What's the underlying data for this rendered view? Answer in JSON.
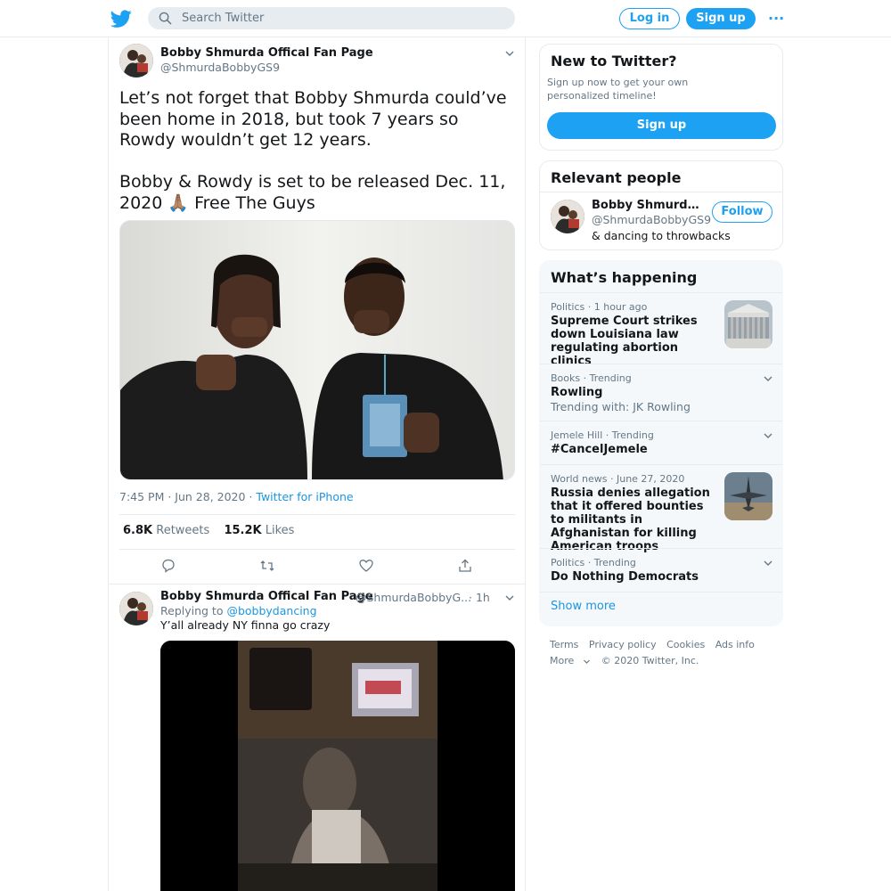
{
  "header": {
    "search_placeholder": "Search Twitter",
    "login_label": "Log in",
    "signup_label": "Sign up",
    "more_icon": "···"
  },
  "tweet": {
    "author_name": "Bobby Shmurda Offical Fan Page",
    "author_handle": "@ShmurdaBobbyGS9",
    "text": "Let’s not forget that Bobby Shmurda could’ve been home in 2018, but took 7 years so Rowdy wouldn’t get 12 years.\n\nBobby & Rowdy is set to be released Dec. 11, 2020 🙏🏽 Free The Guys",
    "time": "7:45 PM · Jun 28, 2020 · ",
    "source": "Twitter for iPhone",
    "retweets_count": "6.8K",
    "retweets_label": "Retweets",
    "likes_count": "15.2K",
    "likes_label": "Likes"
  },
  "reply": {
    "author_name": "Bobby Shmurda Offical Fan Page",
    "author_handle": "@ShmurdaBobbyG...",
    "time": "· 1h",
    "replying_prefix": "Replying to ",
    "replying_to": "@bobbydancing",
    "text": "Y’all already NY finna go crazy"
  },
  "new_to_twitter": {
    "title": "New to Twitter?",
    "description": "Sign up now to get your own personalized timeline!",
    "signup_label": "Sign up"
  },
  "relevant_people": {
    "title": "Relevant people",
    "name": "Bobby Shmurda ...",
    "handle": "@ShmurdaBobbyGS9",
    "bio": "& dancing to throwbacks",
    "follow_label": "Follow"
  },
  "whats_happening": {
    "title": "What’s happening",
    "trends": [
      {
        "meta": "Politics · 1 hour ago",
        "title": "Supreme Court strikes down Louisiana law regulating abortion clinics",
        "sub": ""
      },
      {
        "meta": "Books · Trending",
        "title": "Rowling",
        "sub": "Trending with: JK Rowling"
      },
      {
        "meta": "Jemele Hill · Trending",
        "title": "#CancelJemele",
        "sub": ""
      },
      {
        "meta": "World news · June 27, 2020",
        "title": "Russia denies allegation that it offered bounties to militants in Afghanistan for killing American troops",
        "sub": ""
      },
      {
        "meta": "Politics · Trending",
        "title": "Do Nothing Democrats",
        "sub": ""
      }
    ],
    "show_more": "Show more"
  },
  "footer": {
    "links": [
      "Terms",
      "Privacy policy",
      "Cookies",
      "Ads info"
    ],
    "more": "More",
    "copyright": "© 2020 Twitter, Inc."
  },
  "colors": {
    "accent": "#1da1f2",
    "link": "#1b95e0",
    "secondary_text": "#657786",
    "border": "#e6ecf0",
    "panel": "#f5f8fa"
  }
}
